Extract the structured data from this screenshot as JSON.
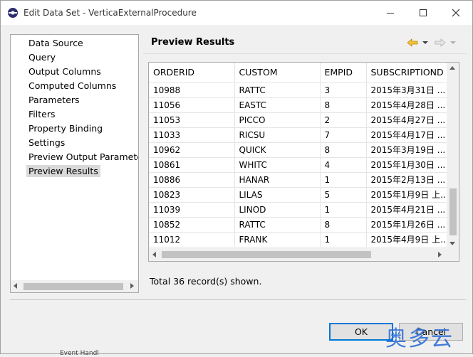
{
  "window": {
    "title": "Edit Data Set - VerticaExternalProcedure"
  },
  "nav": {
    "items": [
      {
        "label": "Data Source",
        "selected": false
      },
      {
        "label": "Query",
        "selected": false
      },
      {
        "label": "Output Columns",
        "selected": false
      },
      {
        "label": "Computed Columns",
        "selected": false
      },
      {
        "label": "Parameters",
        "selected": false
      },
      {
        "label": "Filters",
        "selected": false
      },
      {
        "label": "Property Binding",
        "selected": false
      },
      {
        "label": "Settings",
        "selected": false
      },
      {
        "label": "Preview Output Parameter",
        "selected": false
      },
      {
        "label": "Preview Results",
        "selected": true
      }
    ]
  },
  "panel": {
    "title": "Preview Results"
  },
  "table": {
    "columns": [
      "ORDERID",
      "CUSTOM",
      "EMPID",
      "SUBSCRIPTIOND"
    ],
    "rows": [
      [
        "10988",
        "RATTC",
        "3",
        "2015年3月31日 ..."
      ],
      [
        "11056",
        "EASTC",
        "8",
        "2015年4月28日 ..."
      ],
      [
        "11053",
        "PICCO",
        "2",
        "2015年4月27日 ..."
      ],
      [
        "11033",
        "RICSU",
        "7",
        "2015年4月17日 ..."
      ],
      [
        "10962",
        "QUICK",
        "8",
        "2015年3月19日 ..."
      ],
      [
        "10861",
        "WHITC",
        "4",
        "2015年1月30日 ..."
      ],
      [
        "10886",
        "HANAR",
        "1",
        "2015年2月13日 ..."
      ],
      [
        "10823",
        "LILAS",
        "5",
        "2015年1月9日 上..."
      ],
      [
        "11039",
        "LINOD",
        "1",
        "2015年4月21日 ..."
      ],
      [
        "10852",
        "RATTC",
        "8",
        "2015年1月26日 ..."
      ],
      [
        "11012",
        "FRANK",
        "1",
        "2015年4月9日 上..."
      ]
    ]
  },
  "status": {
    "text": "Total 36 record(s) shown."
  },
  "buttons": {
    "ok": "OK",
    "cancel": "Cancel"
  },
  "watermark": {
    "text": "奥多云"
  },
  "background": {
    "partial_text": "Event Handl"
  },
  "colors": {
    "accent": "#0078d7",
    "icon_back": "#e8a317",
    "selection": "#d9d9d9"
  }
}
